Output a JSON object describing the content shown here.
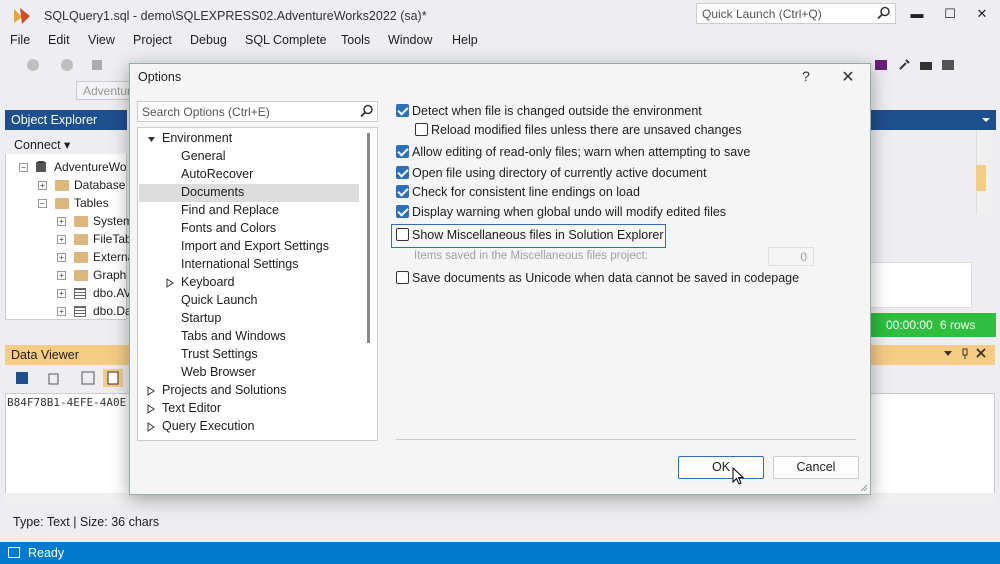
{
  "window": {
    "title": "SQLQuery1.sql - demo\\SQLEXPRESS02.AdventureWorks2022 (sa)*",
    "quick_launch_placeholder": "Quick Launch (Ctrl+Q)",
    "minimize": "▬",
    "maximize": "☐",
    "close": "✕"
  },
  "menu": [
    "File",
    "Edit",
    "View",
    "Project",
    "Debug",
    "SQL Complete",
    "Tools",
    "Window",
    "Help"
  ],
  "toolbar": {
    "database_combo": "Adventure"
  },
  "object_explorer": {
    "title": "Object Explorer",
    "connect": "Connect ▾",
    "nodes": [
      "AdventureWo",
      "Database D",
      "Tables",
      "System",
      "FileTab",
      "Externa",
      "Graph",
      "dbo.AV",
      "dbo.Da"
    ]
  },
  "data_viewer": {
    "title": "Data Viewer",
    "content": "B84F78B1-4EFE-4A0E",
    "status": "Type: Text | Size: 36 chars"
  },
  "results": {
    "time": "00:00:00",
    "rows": "6 rows"
  },
  "status_bar": {
    "text": "Ready"
  },
  "dialog": {
    "title": "Options",
    "help": "?",
    "close": "✕",
    "search_placeholder": "Search Options (Ctrl+E)",
    "tree": [
      {
        "label": "Environment",
        "expanded": true
      },
      {
        "label": "General"
      },
      {
        "label": "AutoRecover"
      },
      {
        "label": "Documents",
        "selected": true
      },
      {
        "label": "Find and Replace"
      },
      {
        "label": "Fonts and Colors"
      },
      {
        "label": "Import and Export Settings"
      },
      {
        "label": "International Settings"
      },
      {
        "label": "Keyboard",
        "collapsed": true
      },
      {
        "label": "Quick Launch"
      },
      {
        "label": "Startup"
      },
      {
        "label": "Tabs and Windows"
      },
      {
        "label": "Trust Settings"
      },
      {
        "label": "Web Browser"
      },
      {
        "label": "Projects and Solutions",
        "collapsed": true
      },
      {
        "label": "Text Editor",
        "collapsed": true
      },
      {
        "label": "Query Execution",
        "collapsed": true
      }
    ],
    "options": [
      {
        "label": "Detect when file is changed outside the environment",
        "checked": true
      },
      {
        "label": "Reload modified files unless there are unsaved changes",
        "checked": false
      },
      {
        "label": "Allow editing of read-only files; warn when attempting to save",
        "checked": true
      },
      {
        "label": "Open file using directory of currently active document",
        "checked": true
      },
      {
        "label": "Check for consistent line endings on load",
        "checked": true
      },
      {
        "label": "Display warning when global undo will modify edited files",
        "checked": true
      },
      {
        "label": "Show Miscellaneous files in Solution Explorer",
        "checked": false
      },
      {
        "label": "Save documents as Unicode when data cannot be saved in codepage",
        "checked": false
      }
    ],
    "items_saved_label": "Items saved in the Miscellaneous files project:",
    "items_saved_value": "0",
    "ok": "OK",
    "cancel": "Cancel"
  }
}
